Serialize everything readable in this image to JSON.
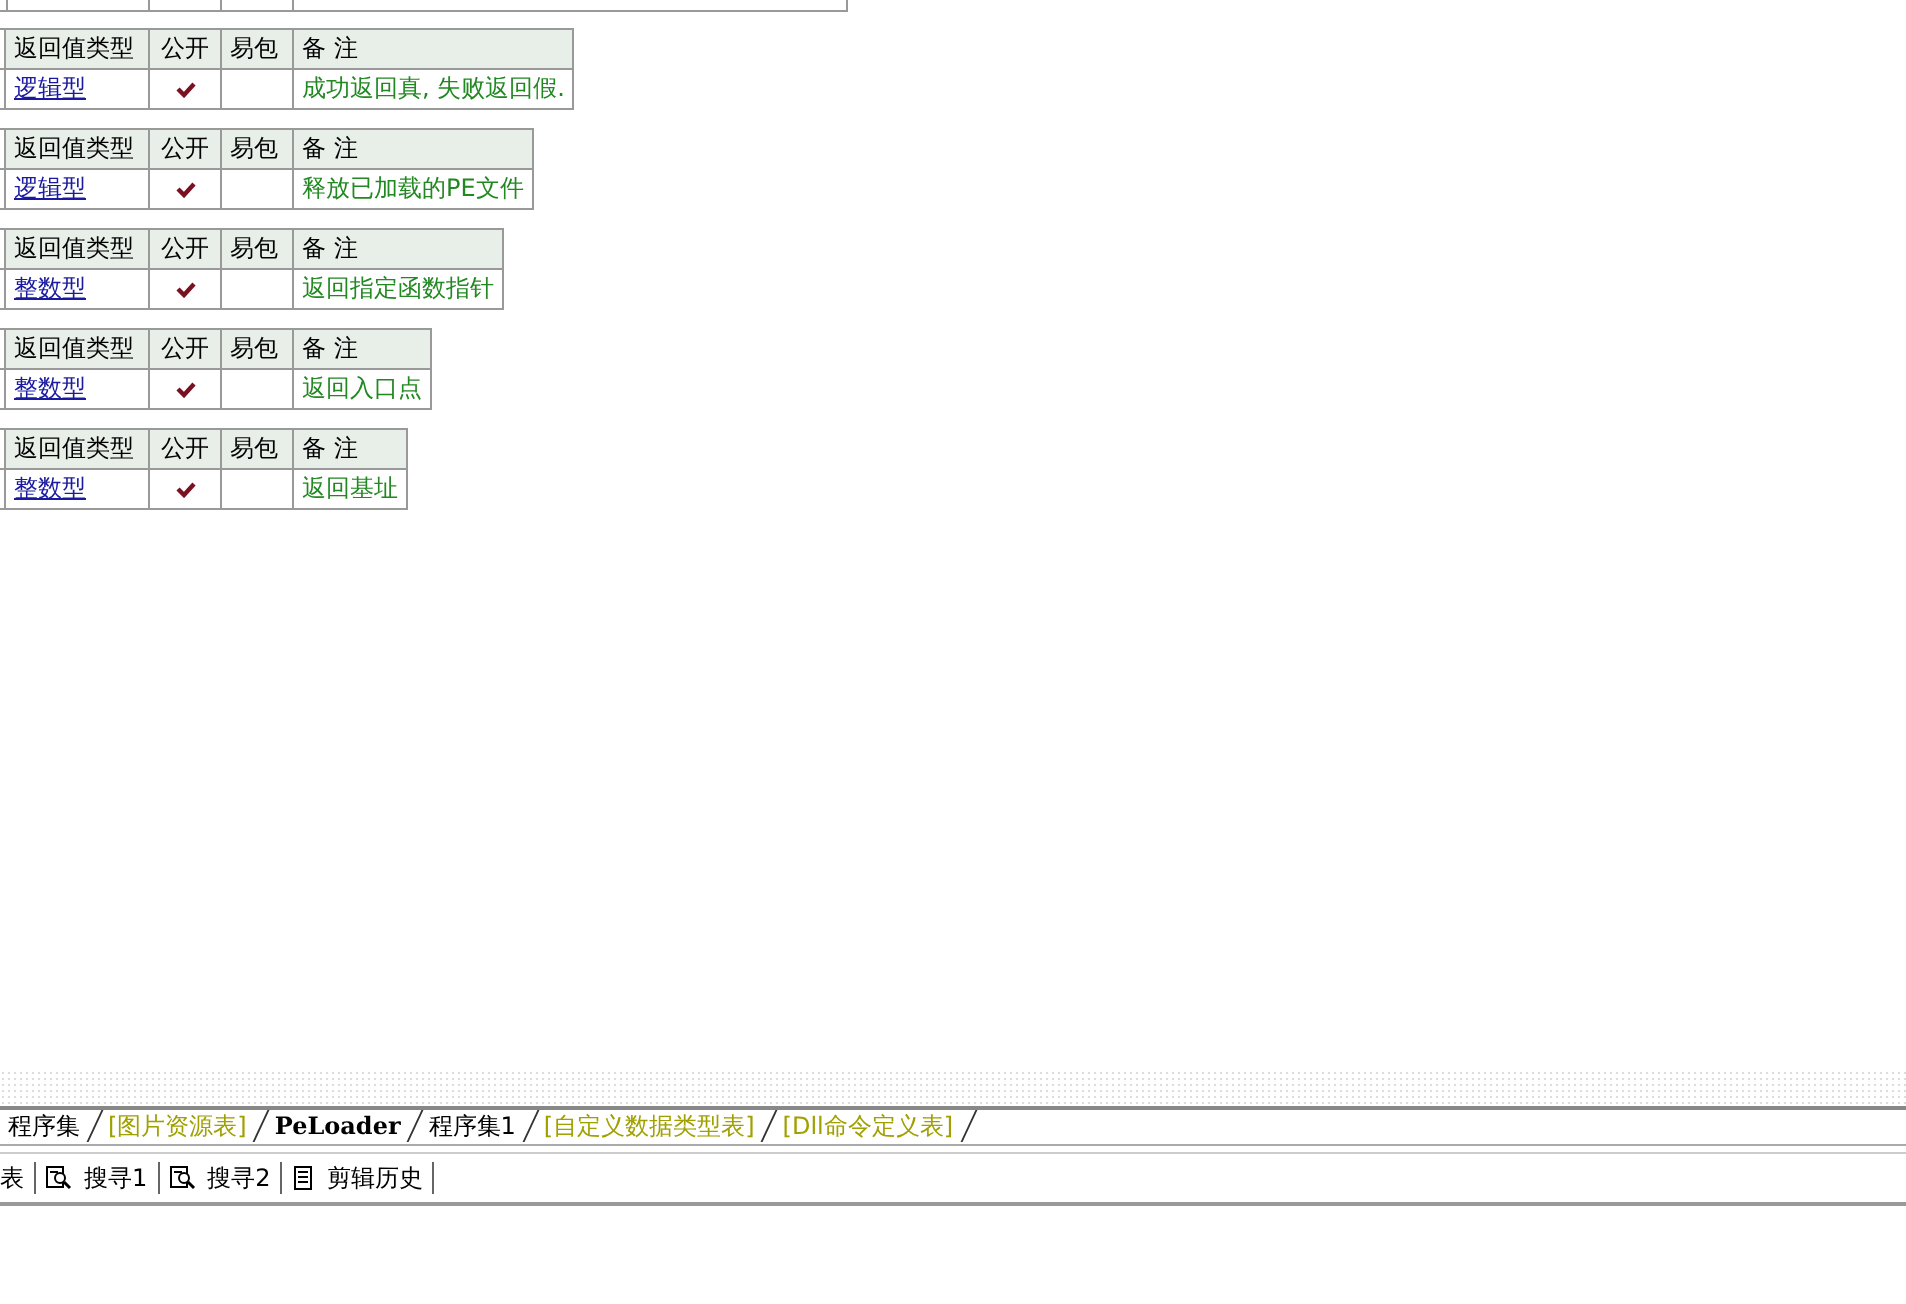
{
  "tables": [
    {
      "header": [
        "返回值类型",
        "公开",
        "易包",
        "备 注"
      ],
      "rows": [
        {
          "return_type": "逻辑型",
          "public": true,
          "epackage": false,
          "note": "成功返回真, 失败返回假."
        }
      ]
    },
    {
      "header": [
        "返回值类型",
        "公开",
        "易包",
        "备 注"
      ],
      "rows": [
        {
          "return_type": "逻辑型",
          "public": true,
          "epackage": false,
          "note": "释放已加载的PE文件"
        }
      ]
    },
    {
      "header": [
        "返回值类型",
        "公开",
        "易包",
        "备 注"
      ],
      "rows": [
        {
          "return_type": "整数型",
          "public": true,
          "epackage": false,
          "note": "返回指定函数指针"
        }
      ]
    },
    {
      "header": [
        "返回值类型",
        "公开",
        "易包",
        "备 注"
      ],
      "rows": [
        {
          "return_type": "整数型",
          "public": true,
          "epackage": false,
          "note": "返回入口点"
        }
      ]
    },
    {
      "header": [
        "返回值类型",
        "公开",
        "易包",
        "备 注"
      ],
      "rows": [
        {
          "return_type": "整数型",
          "public": true,
          "epackage": false,
          "note": "返回基址"
        }
      ]
    }
  ],
  "editor_tabs": [
    {
      "label": "程序集",
      "kind": "module",
      "selected": false
    },
    {
      "label": "[图片资源表]",
      "kind": "table",
      "selected": false
    },
    {
      "label": "PeLoader",
      "kind": "module",
      "selected": true
    },
    {
      "label": "程序集1",
      "kind": "module",
      "selected": false
    },
    {
      "label": "[自定义数据类型表]",
      "kind": "table",
      "selected": false
    },
    {
      "label": "[Dll命令定义表]",
      "kind": "table",
      "selected": false
    }
  ],
  "bottom_tabs": [
    {
      "label": "表",
      "kind": "plain"
    },
    {
      "label": "搜寻1",
      "kind": "search"
    },
    {
      "label": "搜寻2",
      "kind": "search"
    },
    {
      "label": "剪辑历史",
      "kind": "history"
    }
  ]
}
